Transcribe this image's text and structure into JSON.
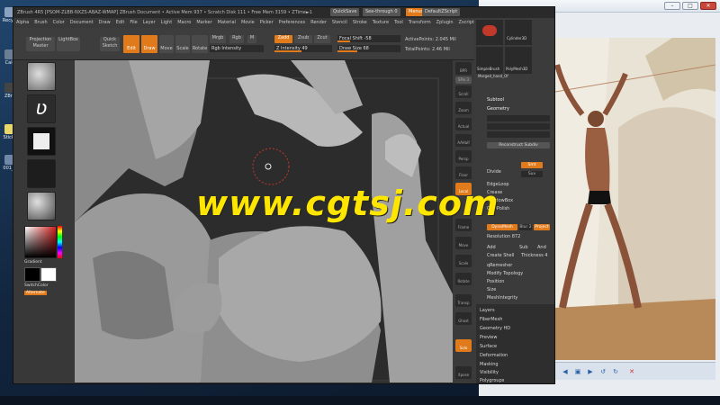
{
  "desktop": {
    "icons": [
      {
        "label": "Recycl"
      },
      {
        "label": "Calc"
      },
      {
        "label": "ZBru"
      },
      {
        "label": "Sticky"
      },
      {
        "label": "001_p"
      }
    ]
  },
  "zbrush": {
    "title": "ZBrush 4R5  [PSOM-ZLBB-NXZS-ABAZ-WMAP]  ZBrush Document  • Active Mem 937 • Scratch Disk 111 • Free Mem 3159 • ZTime►1",
    "quicksave": "QuickSave",
    "seethrough": "See-through  0",
    "menus_btn": "Menus",
    "script_btn": "DefaultZScript",
    "menu": [
      "Alpha",
      "Brush",
      "Color",
      "Document",
      "Draw",
      "Edit",
      "File",
      "Layer",
      "Light",
      "Macro",
      "Marker",
      "Material",
      "Movie",
      "Picker",
      "Preferences",
      "Render",
      "Stencil",
      "Stroke",
      "Texture",
      "Tool",
      "Transform",
      "Zplugin",
      "Zscript"
    ],
    "shelf": {
      "projection_master": "Projection Master",
      "lightbox": "LightBox",
      "quick_sketch": "Quick Sketch",
      "edit": "Edit",
      "draw": "Draw",
      "move": "Move",
      "scale": "Scale",
      "rotate": "Rotate",
      "mrgb": "Mrgb",
      "rgb": "Rgb",
      "m": "M",
      "rgb_intensity": "Rgb Intensity",
      "zadd": "Zadd",
      "zsub": "Zsub",
      "zcut": "Zcut",
      "z_intensity": "Z Intensity 49",
      "focal_shift": "Focal Shift -58",
      "draw_size": "Draw Size 68",
      "active_points": "ActivePoints: 2.045 Mil",
      "total_points": "TotalPoints: 2.46 Mil"
    },
    "left_tray": {
      "gradient": "Gradient",
      "switch_color": "SwitchColor",
      "alternate": "Alternate"
    },
    "right_tray": [
      "BPR",
      "SPix 3",
      "Scroll",
      "Zoom",
      "Actual",
      "AAHalf",
      "Persp",
      "Floor",
      "Local",
      "Frame",
      "Move",
      "Scale",
      "Rotate",
      "Transp",
      "Ghost",
      "Solo",
      "Xpose"
    ],
    "tool_panel": {
      "thumbnails": [
        "Cylinder3D",
        "Merged_Sub",
        "PolyMesh3D",
        "SimpleBrush",
        "Merged_hand_Of"
      ],
      "subtool": "Subtool",
      "geometry": "Geometry",
      "reconstruct_subdiv": "Reconstruct Subdiv",
      "divide": "Divide",
      "smt": "Smt",
      "suv": "Suv",
      "edgeloop": "EdgeLoop",
      "crease": "Crease",
      "shadowbox": "ShadowBox",
      "clay_polish": "ClayPolish",
      "dynamesh": "DynaMesh",
      "blur": "Blur 2",
      "project": "Project",
      "resolution": "Resolution 872",
      "add": "Add",
      "sub": "Sub",
      "and": "And",
      "create_shell": "Create Shell",
      "thickness": "Thickness 4",
      "zremesher": "qRemesher",
      "modify_topology": "Modify Topology",
      "position": "Position",
      "size": "Size",
      "mesh_integrity": "MeshIntegrity",
      "sections": [
        "Layers",
        "FiberMesh",
        "Geometry HD",
        "Preview",
        "Surface",
        "Deformation",
        "Masking",
        "Visibility",
        "Polygroups"
      ]
    }
  },
  "watermark": "www.cgtsj.com",
  "photo_viewer": {
    "title": ""
  }
}
